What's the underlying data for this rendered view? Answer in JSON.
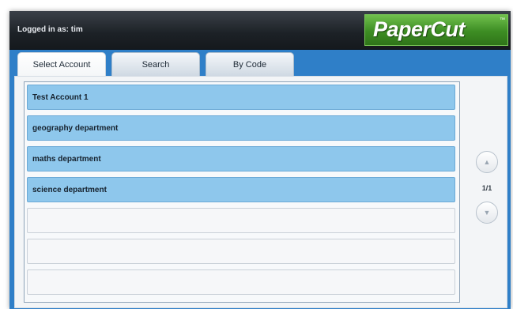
{
  "header": {
    "logged_in_text": "Logged in as: tim",
    "logo_text": "PaperCut",
    "logo_tm": "™"
  },
  "tabs": [
    {
      "label": "Select Account",
      "active": true
    },
    {
      "label": "Search",
      "active": false
    },
    {
      "label": "By Code",
      "active": false
    }
  ],
  "accounts": [
    {
      "label": "Test Account 1"
    },
    {
      "label": "geography department"
    },
    {
      "label": "maths department"
    },
    {
      "label": "science department"
    },
    {
      "label": ""
    },
    {
      "label": ""
    },
    {
      "label": ""
    }
  ],
  "pager": {
    "indicator": "1/1",
    "up_icon": "triangle-up-icon",
    "down_icon": "triangle-down-icon"
  },
  "colors": {
    "frame_blue": "#2f7fc8",
    "row_blue": "#8ec7ec",
    "logo_green": "#4aa22c",
    "header_dark": "#1c2126"
  }
}
